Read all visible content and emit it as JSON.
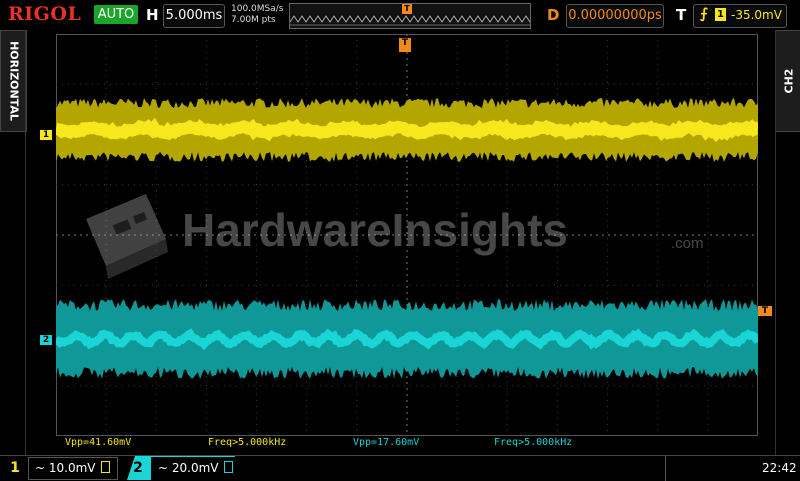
{
  "topbar": {
    "logo": "RIGOL",
    "trigger_status": "AUTO",
    "horizontal_label": "H",
    "timebase": "5.000ms",
    "sample_rate": "100.0MSa/s",
    "memory_depth": "7.00M pts",
    "trigger_pos_marker": "T",
    "delay_label": "D",
    "delay_value": "0.00000000ps",
    "trigger_label": "T",
    "trigger_slope": "⨍",
    "trigger_source": "1",
    "trigger_level": "-35.0mV"
  },
  "side_tabs": {
    "left": "HORIZONTAL",
    "right": "CH2"
  },
  "markers": {
    "ch1": "1",
    "ch2": "2",
    "trigger_level": "T",
    "trigger_position": "T"
  },
  "watermark": {
    "text": "HardwareInsights",
    "suffix": ".com"
  },
  "measurements": [
    {
      "text": "Vpp=41.60mV",
      "channel": "1"
    },
    {
      "text": "Freq>5.000kHz",
      "channel": "1"
    },
    {
      "text": "Vpp=17.60mV",
      "channel": "2"
    },
    {
      "text": "Freq>5.000kHz",
      "channel": "2"
    }
  ],
  "bottombar": {
    "ch1": {
      "number": "1",
      "setting": "~ 10.0mV"
    },
    "ch2": {
      "number": "2",
      "setting": "~ 20.0mV"
    },
    "clock": "22:42"
  },
  "colors": {
    "ch1": "#f8e71c",
    "ch1_envelope": "#b3a600",
    "ch2": "#19d5d5",
    "ch2_envelope": "#109898",
    "accent": "#f08a1c",
    "logo": "#e8322a",
    "status": "#1aa52a"
  }
}
